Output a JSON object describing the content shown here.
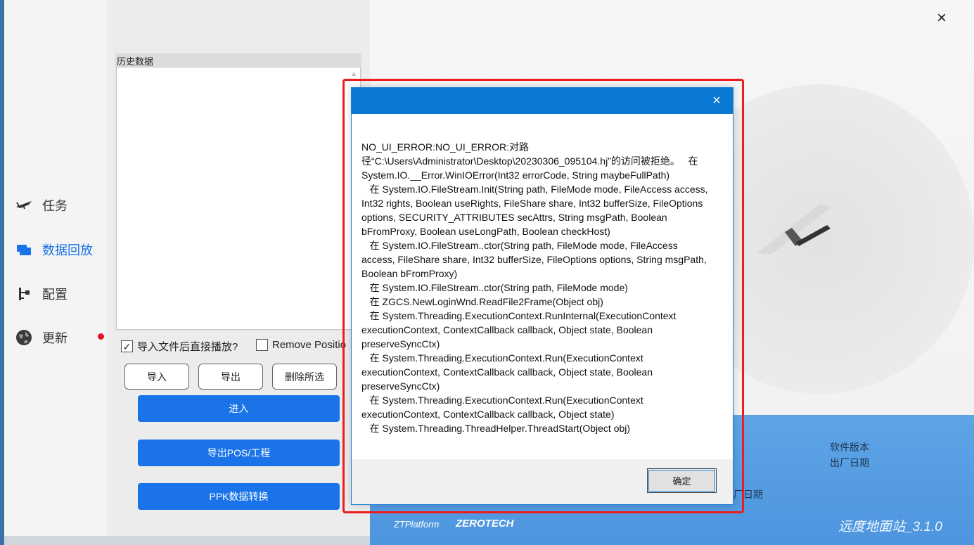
{
  "nav": {
    "items": [
      {
        "label": "任务"
      },
      {
        "label": "数据回放"
      },
      {
        "label": "配置"
      },
      {
        "label": "更新"
      }
    ]
  },
  "panel": {
    "history_label": "历史数据",
    "autoplay_checkbox": "导入文件后直接播放?",
    "autoplay_checked": true,
    "remove_position_checkbox": "Remove Positio",
    "remove_position_checked": false,
    "import_label": "导入",
    "export_label": "导出",
    "delete_selected_label": "删除所选",
    "enter_label": "进入",
    "export_pos_label": "导出POS/工程",
    "ppk_label": "PPK数据转换"
  },
  "hero": {
    "close_icon": "×",
    "software_version_label": "软件版本",
    "release_date_label": "出厂日期",
    "release_date_partial": "厂日期",
    "brand_zt": "ZTPlatform",
    "brand_zerotech": "ZEROTECH",
    "app_version": "远度地面站_3.1.0"
  },
  "dialog": {
    "close_icon": "×",
    "message": "NO_UI_ERROR:NO_UI_ERROR:对路径“C:\\Users\\Administrator\\Desktop\\20230306_095104.hj”的访问被拒绝。   在 System.IO.__Error.WinIOError(Int32 errorCode, String maybeFullPath)\n   在 System.IO.FileStream.Init(String path, FileMode mode, FileAccess access, Int32 rights, Boolean useRights, FileShare share, Int32 bufferSize, FileOptions options, SECURITY_ATTRIBUTES secAttrs, String msgPath, Boolean bFromProxy, Boolean useLongPath, Boolean checkHost)\n   在 System.IO.FileStream..ctor(String path, FileMode mode, FileAccess access, FileShare share, Int32 bufferSize, FileOptions options, String msgPath, Boolean bFromProxy)\n   在 System.IO.FileStream..ctor(String path, FileMode mode)\n   在 ZGCS.NewLoginWnd.ReadFile2Frame(Object obj)\n   在 System.Threading.ExecutionContext.RunInternal(ExecutionContext executionContext, ContextCallback callback, Object state, Boolean preserveSyncCtx)\n   在 System.Threading.ExecutionContext.Run(ExecutionContext executionContext, ContextCallback callback, Object state, Boolean preserveSyncCtx)\n   在 System.Threading.ExecutionContext.Run(ExecutionContext executionContext, ContextCallback callback, Object state)\n   在 System.Threading.ThreadHelper.ThreadStart(Object obj)",
    "ok_label": "确定"
  },
  "colors": {
    "accent": "#1a73e8",
    "dialog_title": "#0b78d4",
    "highlight": "#ee1c1c",
    "notify_dot": "#e81123"
  }
}
